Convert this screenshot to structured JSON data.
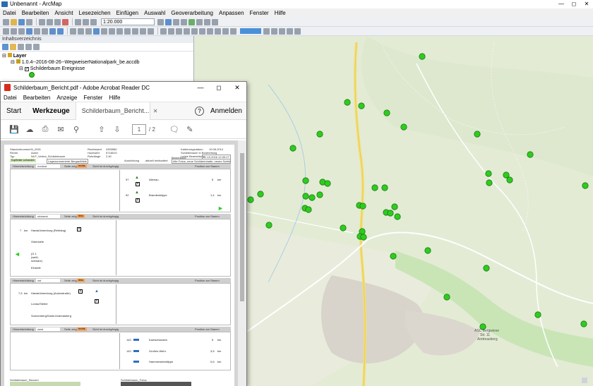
{
  "arcmap": {
    "title": "Unbenannt - ArcMap",
    "menu": [
      "Datei",
      "Bearbeiten",
      "Ansicht",
      "Lesezeichen",
      "Einfügen",
      "Auswahl",
      "Geoverarbeitung",
      "Anpassen",
      "Fenster",
      "Hilfe"
    ],
    "scale": "1:20.000",
    "toc_title": "Inhaltsverzeichnis",
    "toc": {
      "root": "Layer",
      "database": "1.0.4--2016-08-26--WegweiserNationalpark_be.accdb",
      "layer": "Schilderbaum Ereignisse"
    },
    "colors": {
      "point": "#2ecc1e",
      "map_bg": "#e4ecd6",
      "urban": "#d6d2cc",
      "road": "#f5e58a"
    }
  },
  "acrobat": {
    "title": "Schilderbaum_Bericht.pdf - Adobe Acrobat Reader DC",
    "menu": [
      "Datei",
      "Bearbeiten",
      "Anzeige",
      "Fenster",
      "Hilfe"
    ],
    "tabs": {
      "start": "Start",
      "tools": "Werkzeuge",
      "doc": "Schilderbaum_Bericht..."
    },
    "help_icon": "?",
    "signin": "Anmelden",
    "page_current": "1",
    "page_total": "/ 2",
    "report": {
      "standort_label": "Standortnummer",
      "standort": "N_0001",
      "revier_label": "Revier",
      "revier": "Acker",
      "typ_label": "Typ",
      "typ": "NLP_Verbot_Schilderbaum",
      "rechtswert_label": "Rechtswert",
      "rechtswert": "4393580",
      "hochwert_label": "Hochwert",
      "hochwert": "5718010",
      "hoehe_label": "Rohrlänge",
      "hoehe": "2.40",
      "date_label": "Kartierungsdatum",
      "date": "19.06.2014",
      "edit_label": "Letzte Bearbeitung",
      "edit": "21.10.2016 12:00:27",
      "status_label": "Schilderbaum in Bearbeitung",
      "tag1": "Kopfleiste vorhanden",
      "tag2": "Lagenummerierte Bergaufbilds",
      "ausrichtung_label": "Ausrichtung",
      "ausrichtung": "aktuell reinkartiert",
      "bemerkung_label": "Bemerkung",
      "bemerkung": "Alle Fotos, neue Schilderinhalte, neues Schild im Aufbau",
      "sections": [
        {
          "dir": "nordost",
          "side": "Seite zeigt",
          "lr": "rechts",
          "label": "Sicht ist durchgängig",
          "pos": "Position am Stamm",
          "rows": [
            {
              "nr": "97",
              "dest": "Altenau",
              "km": "5",
              "unit": "km"
            },
            {
              "nr": "92",
              "dest": "Brandenklippe",
              "km": "1,4",
              "unit": "km"
            }
          ]
        },
        {
          "dir": "südwest",
          "side": "Seite zeigt",
          "lr": "links",
          "label": "Sicht ist durchgängig",
          "pos": "Position am Stamm",
          "rows": [
            {
              "nr": "7",
              "dest": "Hanskühnenburg (Rehtsbg)",
              "km": "",
              "unit": "km"
            },
            {
              "nr": "",
              "dest": "Ostersiele",
              "km": "",
              "unit": ""
            },
            {
              "nr": "",
              "dest": "(G 1 (weiß, schwarz)",
              "km": "",
              "unit": ""
            },
            {
              "nr": "",
              "dest": "Eintrefe",
              "km": "",
              "unit": ""
            }
          ]
        },
        {
          "dir": "ost",
          "side": "Seite zeigt",
          "lr": "links",
          "label": "Sicht ist durchgängig",
          "pos": "Position am Stamm",
          "rows": [
            {
              "nr": "7,5",
              "dest": "Hanskühnenburg (Ackerstraße)",
              "km": "",
              "unit": "km"
            },
            {
              "nr": "",
              "dest": "Lonau/Sieber",
              "km": "",
              "unit": ""
            },
            {
              "nr": "",
              "dest": "Sonnenberg/Sankt Andreasberg",
              "km": "",
              "unit": ""
            }
          ]
        },
        {
          "dir": "west",
          "side": "Seite zeigt",
          "lr": "rechts",
          "label": "Sicht ist durchgängig",
          "pos": "Position am Stamm",
          "rows": [
            {
              "nr": "14C",
              "dest": "Kamschlacken",
              "km": "5",
              "unit": "km"
            },
            {
              "nr": "14C",
              "dest": "Großes Wehr",
              "km": "3,5",
              "unit": "km"
            },
            {
              "nr": "",
              "dest": "Hammersteinklippe",
              "km": "0,6",
              "unit": "km"
            }
          ]
        }
      ],
      "footer_left": "Schilderbaum_Skizzen",
      "footer_right": "Schilderbaum_Fotos"
    }
  },
  "map": {
    "labels": [
      "ASC Bergwiese",
      "Str. 11",
      "Andreasberg"
    ],
    "points": [
      [
        320,
        28
      ],
      [
        326,
        29
      ],
      [
        601,
        28
      ],
      [
        598,
        80
      ],
      [
        492,
        145
      ],
      [
        512,
        150
      ],
      [
        548,
        160
      ],
      [
        572,
        180
      ],
      [
        453,
        190
      ],
      [
        676,
        190
      ],
      [
        415,
        210
      ],
      [
        751,
        219
      ],
      [
        433,
        256
      ],
      [
        457,
        258
      ],
      [
        464,
        260
      ],
      [
        692,
        246
      ],
      [
        717,
        248
      ],
      [
        722,
        255
      ],
      [
        693,
        259
      ],
      [
        829,
        263
      ],
      [
        433,
        278
      ],
      [
        442,
        280
      ],
      [
        453,
        276
      ],
      [
        531,
        266
      ],
      [
        545,
        266
      ],
      [
        369,
        275
      ],
      [
        355,
        283
      ],
      [
        432,
        295
      ],
      [
        437,
        297
      ],
      [
        509,
        291
      ],
      [
        514,
        292
      ],
      [
        559,
        293
      ],
      [
        547,
        301
      ],
      [
        553,
        302
      ],
      [
        563,
        307
      ],
      [
        486,
        323
      ],
      [
        513,
        328
      ],
      [
        510,
        335
      ],
      [
        515,
        336
      ],
      [
        381,
        319
      ],
      [
        606,
        355
      ],
      [
        557,
        363
      ],
      [
        689,
        380
      ],
      [
        633,
        421
      ],
      [
        684,
        463
      ],
      [
        762,
        446
      ],
      [
        827,
        459
      ]
    ]
  }
}
